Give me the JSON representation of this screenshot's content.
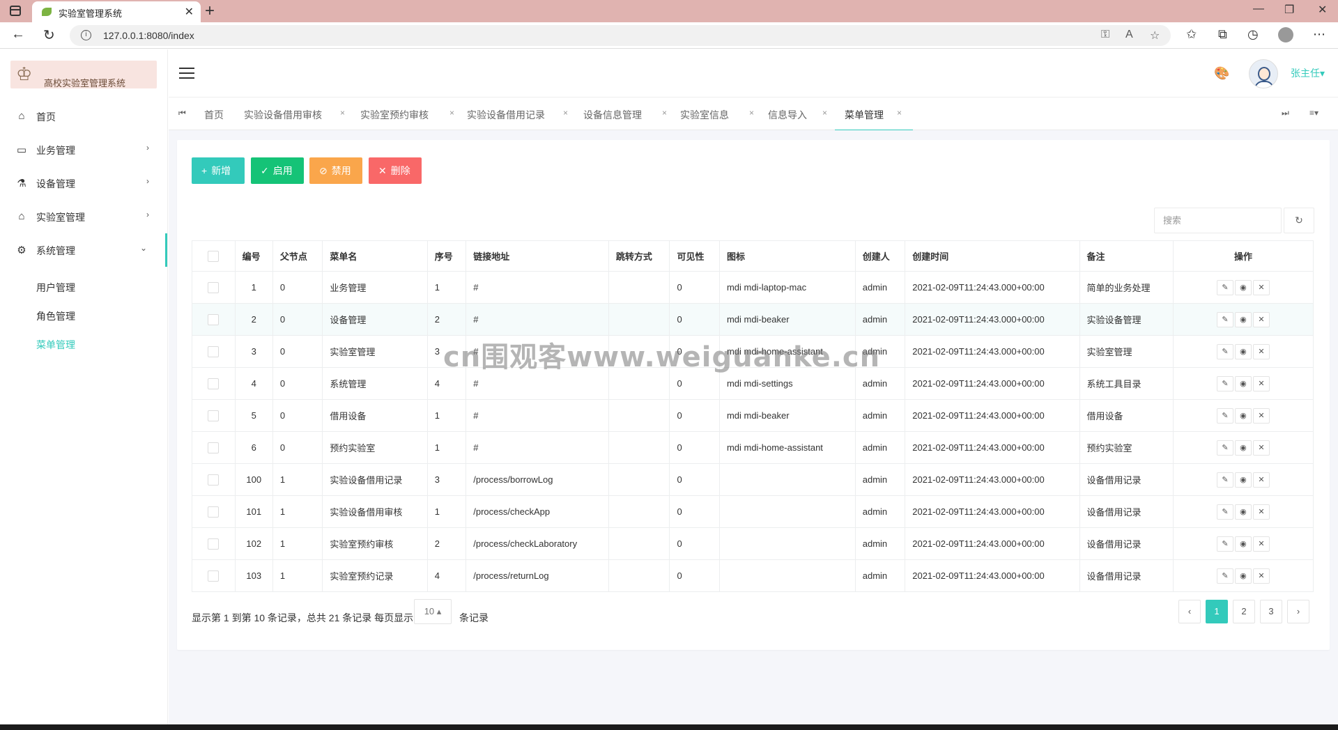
{
  "browser": {
    "tab_title": "实验室管理系统",
    "url": "127.0.0.1:8080/index"
  },
  "app": {
    "logo_text": "高校实验室管理系统",
    "user_name": "张主任▾"
  },
  "sidebar": {
    "items": [
      {
        "label": "首页",
        "icon": "home-icon"
      },
      {
        "label": "业务管理",
        "icon": "laptop-icon"
      },
      {
        "label": "设备管理",
        "icon": "beaker-icon"
      },
      {
        "label": "实验室管理",
        "icon": "home-assistant-icon"
      },
      {
        "label": "系统管理",
        "icon": "settings-icon"
      }
    ],
    "submenu": [
      {
        "label": "用户管理"
      },
      {
        "label": "角色管理"
      },
      {
        "label": "菜单管理"
      }
    ]
  },
  "tabs": [
    {
      "label": "首页"
    },
    {
      "label": "实验设备借用审核"
    },
    {
      "label": "实验室预约审核"
    },
    {
      "label": "实验设备借用记录"
    },
    {
      "label": "设备信息管理"
    },
    {
      "label": "实验室信息"
    },
    {
      "label": "信息导入"
    },
    {
      "label": "菜单管理"
    }
  ],
  "toolbar": {
    "add_label": "新增",
    "enable_label": "启用",
    "disable_label": "禁用",
    "delete_label": "删除"
  },
  "search": {
    "placeholder": "搜索"
  },
  "table": {
    "columns": [
      "编号",
      "父节点",
      "菜单名",
      "序号",
      "链接地址",
      "跳转方式",
      "可见性",
      "图标",
      "创建人",
      "创建时间",
      "备注",
      "操作"
    ],
    "rows": [
      {
        "id": "1",
        "parent": "0",
        "name": "业务管理",
        "order": "1",
        "url": "#",
        "target": "",
        "visible": "0",
        "icon": "mdi mdi-laptop-mac",
        "creator": "admin",
        "created": "2021-02-09T11:24:43.000+00:00",
        "remark": "简单的业务处理"
      },
      {
        "id": "2",
        "parent": "0",
        "name": "设备管理",
        "order": "2",
        "url": "#",
        "target": "",
        "visible": "0",
        "icon": "mdi mdi-beaker",
        "creator": "admin",
        "created": "2021-02-09T11:24:43.000+00:00",
        "remark": "实验设备管理"
      },
      {
        "id": "3",
        "parent": "0",
        "name": "实验室管理",
        "order": "3",
        "url": "#",
        "target": "",
        "visible": "0",
        "icon": "mdi mdi-home-assistant",
        "creator": "admin",
        "created": "2021-02-09T11:24:43.000+00:00",
        "remark": "实验室管理"
      },
      {
        "id": "4",
        "parent": "0",
        "name": "系统管理",
        "order": "4",
        "url": "#",
        "target": "",
        "visible": "0",
        "icon": "mdi mdi-settings",
        "creator": "admin",
        "created": "2021-02-09T11:24:43.000+00:00",
        "remark": "系统工具目录"
      },
      {
        "id": "5",
        "parent": "0",
        "name": "借用设备",
        "order": "1",
        "url": "#",
        "target": "",
        "visible": "0",
        "icon": "mdi mdi-beaker",
        "creator": "admin",
        "created": "2021-02-09T11:24:43.000+00:00",
        "remark": "借用设备"
      },
      {
        "id": "6",
        "parent": "0",
        "name": "预约实验室",
        "order": "1",
        "url": "#",
        "target": "",
        "visible": "0",
        "icon": "mdi mdi-home-assistant",
        "creator": "admin",
        "created": "2021-02-09T11:24:43.000+00:00",
        "remark": "预约实验室"
      },
      {
        "id": "100",
        "parent": "1",
        "name": "实验设备借用记录",
        "order": "3",
        "url": "/process/borrowLog",
        "target": "",
        "visible": "0",
        "icon": "",
        "creator": "admin",
        "created": "2021-02-09T11:24:43.000+00:00",
        "remark": "设备借用记录"
      },
      {
        "id": "101",
        "parent": "1",
        "name": "实验设备借用审核",
        "order": "1",
        "url": "/process/checkApp",
        "target": "",
        "visible": "0",
        "icon": "",
        "creator": "admin",
        "created": "2021-02-09T11:24:43.000+00:00",
        "remark": "设备借用记录"
      },
      {
        "id": "102",
        "parent": "1",
        "name": "实验室预约审核",
        "order": "2",
        "url": "/process/checkLaboratory",
        "target": "",
        "visible": "0",
        "icon": "",
        "creator": "admin",
        "created": "2021-02-09T11:24:43.000+00:00",
        "remark": "设备借用记录"
      },
      {
        "id": "103",
        "parent": "1",
        "name": "实验室预约记录",
        "order": "4",
        "url": "/process/returnLog",
        "target": "",
        "visible": "0",
        "icon": "",
        "creator": "admin",
        "created": "2021-02-09T11:24:43.000+00:00",
        "remark": "设备借用记录"
      }
    ]
  },
  "pagination": {
    "info_prefix": "显示第 1 到第 10 条记录，总共 21 条记录  每页显示",
    "page_size": "10 ▴",
    "info_suffix": "条记录",
    "prev": "‹",
    "pages": [
      "1",
      "2",
      "3"
    ],
    "next": "›"
  },
  "watermark": "cn围观客www.weiguanke.cn",
  "colors": {
    "accent": "#33cabb",
    "success": "#15c377",
    "warning": "#faa64b",
    "danger": "#f96868"
  }
}
